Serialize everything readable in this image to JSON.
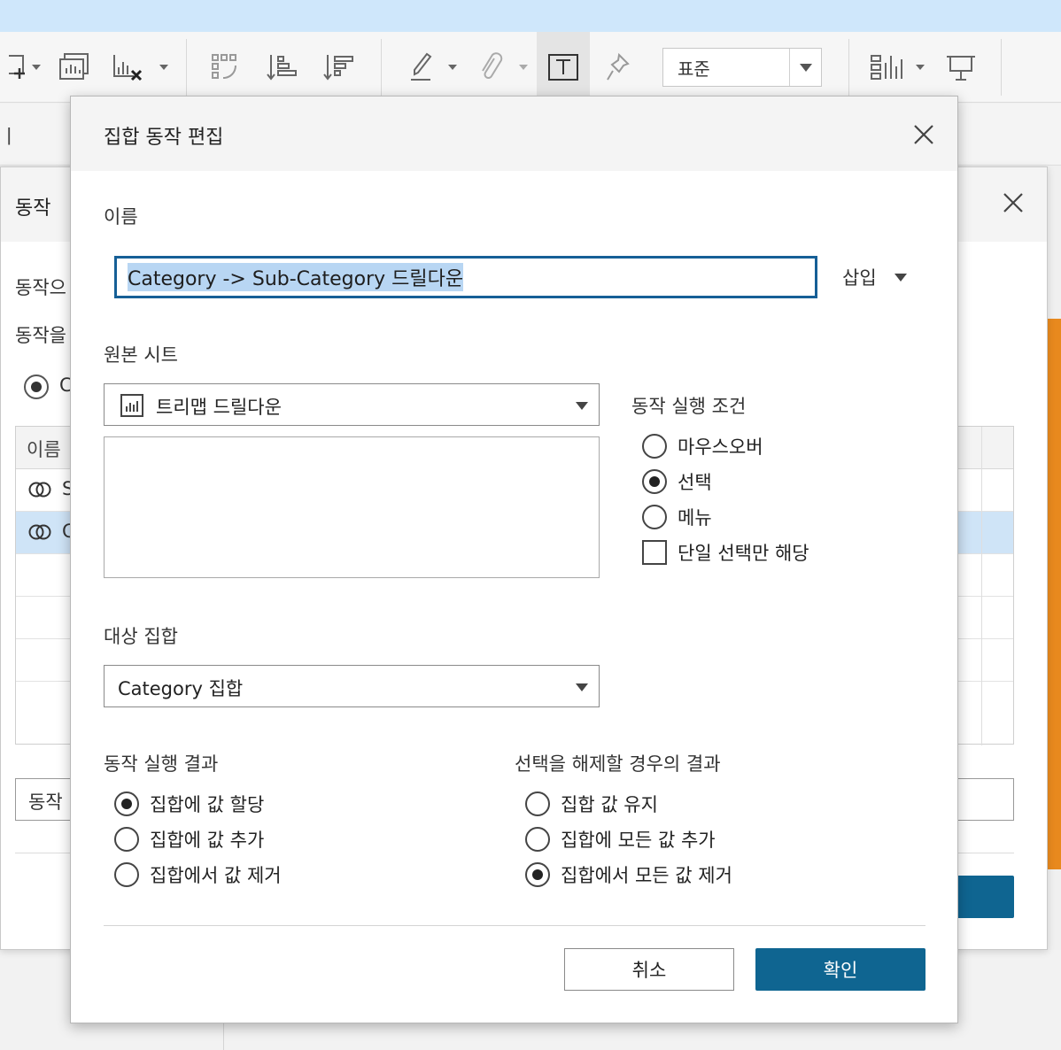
{
  "toolbar": {
    "format_select": "표준"
  },
  "background_dialog": {
    "title": "동작",
    "text_line1": "동작으",
    "text_line2": "동작을",
    "radio_partial": "C",
    "table_header": "이름",
    "rows": [
      {
        "label": "S"
      },
      {
        "label": "C"
      }
    ],
    "add_button_partial": "동작"
  },
  "dialog": {
    "title": "집합 동작 편집",
    "name_label": "이름",
    "name_value": "Category -> Sub-Category 드릴다운",
    "insert_label": "삽입",
    "source_sheet_label": "원본 시트",
    "source_sheet_value": "트리맵 드릴다운",
    "run_condition_label": "동작 실행 조건",
    "run_condition_options": [
      {
        "label": "마우스오버",
        "checked": false
      },
      {
        "label": "선택",
        "checked": true
      },
      {
        "label": "메뉴",
        "checked": false
      }
    ],
    "single_select_label": "단일 선택만 해당",
    "single_select_checked": false,
    "target_set_label": "대상 집합",
    "target_set_value": "Category 집합",
    "result_label": "동작 실행 결과",
    "result_options": [
      {
        "label": "집합에 값 할당",
        "checked": true
      },
      {
        "label": "집합에 값 추가",
        "checked": false
      },
      {
        "label": "집합에서 값 제거",
        "checked": false
      }
    ],
    "clear_label": "선택을 해제할 경우의 결과",
    "clear_options": [
      {
        "label": "집합 값 유지",
        "checked": false
      },
      {
        "label": "집합에 모든 값 추가",
        "checked": false
      },
      {
        "label": "집합에서 모든 값 제거",
        "checked": true
      }
    ],
    "cancel_label": "취소",
    "ok_label": "확인"
  },
  "colors": {
    "accent": "#0f6591",
    "input_focus": "#165f96",
    "selection": "#b8d6f3",
    "topbar": "#cfe7fb",
    "orange": "#e8891e"
  }
}
